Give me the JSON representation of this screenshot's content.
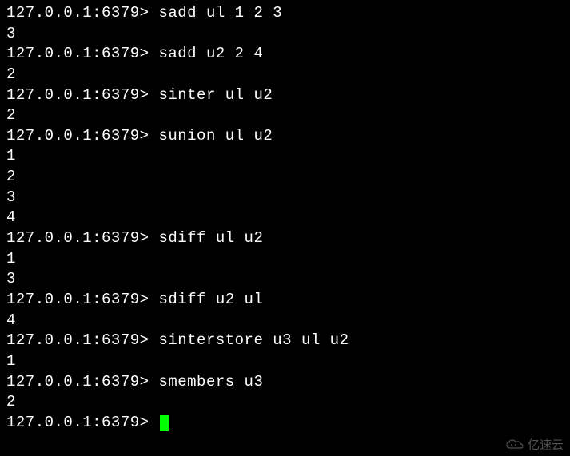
{
  "terminal": {
    "prompt": "127.0.0.1:6379>",
    "lines": [
      {
        "type": "cmd",
        "text": "sadd ul 1 2 3"
      },
      {
        "type": "out",
        "text": "3"
      },
      {
        "type": "cmd",
        "text": "sadd u2 2 4"
      },
      {
        "type": "out",
        "text": "2"
      },
      {
        "type": "cmd",
        "text": "sinter ul u2"
      },
      {
        "type": "out",
        "text": "2"
      },
      {
        "type": "cmd",
        "text": "sunion ul u2"
      },
      {
        "type": "out",
        "text": "1"
      },
      {
        "type": "out",
        "text": "2"
      },
      {
        "type": "out",
        "text": "3"
      },
      {
        "type": "out",
        "text": "4"
      },
      {
        "type": "cmd",
        "text": "sdiff ul u2"
      },
      {
        "type": "out",
        "text": "1"
      },
      {
        "type": "out",
        "text": "3"
      },
      {
        "type": "cmd",
        "text": "sdiff u2 ul"
      },
      {
        "type": "out",
        "text": "4"
      },
      {
        "type": "cmd",
        "text": "sinterstore u3 ul u2"
      },
      {
        "type": "out",
        "text": "1"
      },
      {
        "type": "cmd",
        "text": "smembers u3"
      },
      {
        "type": "out",
        "text": "2"
      },
      {
        "type": "cmd-cursor",
        "text": ""
      }
    ]
  },
  "watermark": {
    "text": "亿速云"
  }
}
